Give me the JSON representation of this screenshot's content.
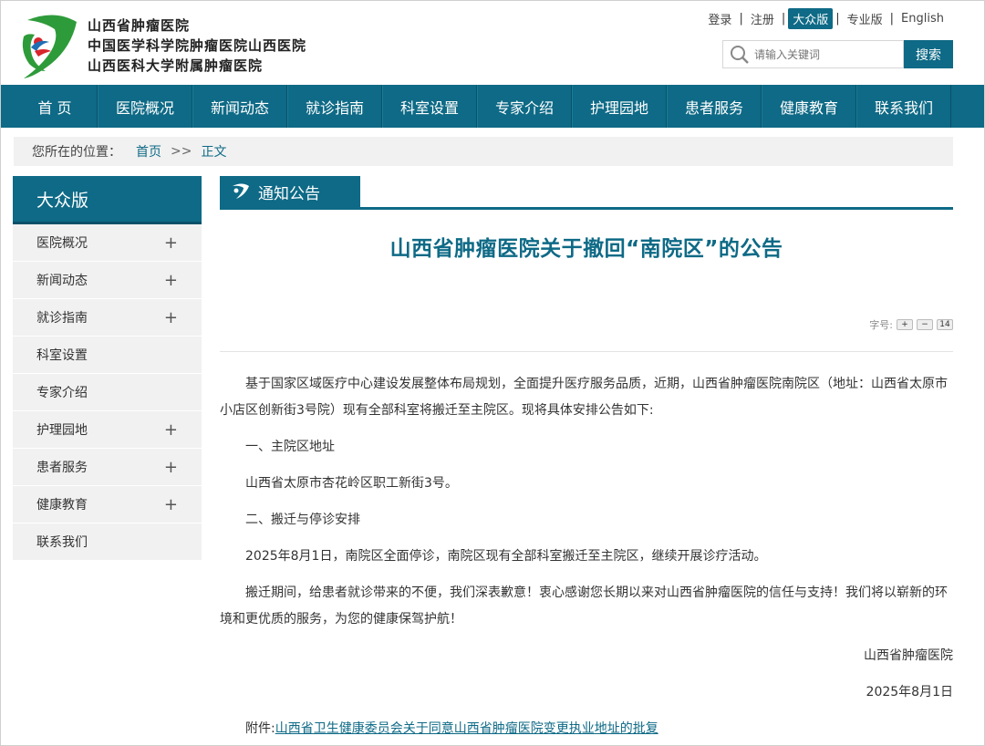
{
  "header": {
    "names": [
      "山西省肿瘤医院",
      "中国医学科学院肿瘤医院山西医院",
      "山西医科大学附属肿瘤医院"
    ],
    "links": [
      {
        "label": "登录",
        "active": false
      },
      {
        "label": "注册",
        "active": false
      },
      {
        "label": "大众版",
        "active": true
      },
      {
        "label": "专业版",
        "active": false
      },
      {
        "label": "English",
        "active": false
      }
    ],
    "search": {
      "placeholder": "请输入关键词",
      "button": "搜索"
    }
  },
  "nav": [
    "首 页",
    "医院概况",
    "新闻动态",
    "就诊指南",
    "科室设置",
    "专家介绍",
    "护理园地",
    "患者服务",
    "健康教育",
    "联系我们"
  ],
  "breadcrumb": {
    "label": "您所在的位置：",
    "home": "首页",
    "arrow": ">>",
    "current": "正文"
  },
  "sidebar": {
    "title": "大众版",
    "items": [
      {
        "label": "医院概况",
        "expandable": true
      },
      {
        "label": "新闻动态",
        "expandable": true
      },
      {
        "label": "就诊指南",
        "expandable": true
      },
      {
        "label": "科室设置",
        "expandable": false
      },
      {
        "label": "专家介绍",
        "expandable": false
      },
      {
        "label": "护理园地",
        "expandable": true
      },
      {
        "label": "患者服务",
        "expandable": true
      },
      {
        "label": "健康教育",
        "expandable": true
      },
      {
        "label": "联系我们",
        "expandable": false
      }
    ],
    "plus": "+"
  },
  "article": {
    "tab": "通知公告",
    "title": "山西省肿瘤医院关于撤回“南院区”的公告",
    "font_label": "字号:",
    "font_buttons": [
      "+",
      "−",
      "14"
    ],
    "paragraphs": [
      "基于国家区域医疗中心建设发展整体布局规划，全面提升医疗服务品质，近期，山西省肿瘤医院南院区（地址：山西省太原市小店区创新街3号院）现有全部科室将搬迁至主院区。现将具体安排公告如下:",
      "一、主院区地址",
      "山西省太原市杏花岭区职工新街3号。",
      "二、搬迁与停诊安排",
      "2025年8月1日，南院区全面停诊，南院区现有全部科室搬迁至主院区，继续开展诊疗活动。",
      "搬迁期间，给患者就诊带来的不便，我们深表歉意！衷心感谢您长期以来对山西省肿瘤医院的信任与支持！我们将以崭新的环境和更优质的服务，为您的健康保驾护航！"
    ],
    "signature": "山西省肿瘤医院",
    "date": "2025年8月1日",
    "attachment_label": "附件:",
    "attachment_link": "山西省卫生健康委员会关于同意山西省肿瘤医院变更执业地址的批复"
  },
  "colors": {
    "primary": "#0e6a86",
    "logo_green": "#2e9b3a",
    "logo_red": "#d8262c",
    "logo_blue": "#1f6fb5"
  }
}
